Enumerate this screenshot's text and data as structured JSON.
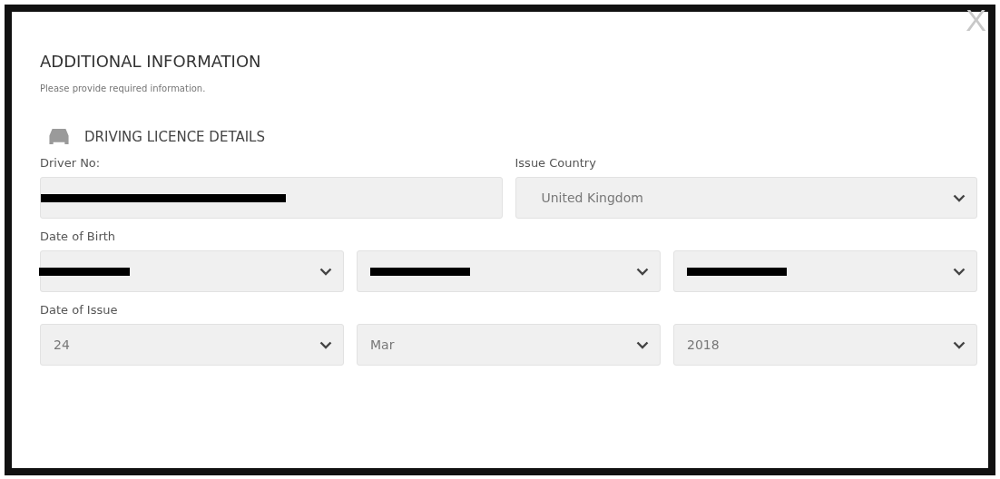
{
  "dialog": {
    "close": "X",
    "title": "ADDITIONAL INFORMATION",
    "subtitle": "Please provide required information."
  },
  "section": {
    "title": "DRIVING LICENCE DETAILS"
  },
  "rows": [
    {
      "fields": [
        {
          "label": "Driver No:",
          "kind": "input",
          "redacted": true
        },
        {
          "label": "Issue Country",
          "kind": "select",
          "value": "United Kingdom",
          "redacted": false
        }
      ]
    },
    {
      "label": "Date of Birth",
      "fields": [
        {
          "kind": "select",
          "redacted": true
        },
        {
          "kind": "select",
          "redacted": true
        },
        {
          "kind": "select",
          "redacted": true
        }
      ]
    },
    {
      "label": "Date of Issue",
      "fields": [
        {
          "kind": "select",
          "value": "24",
          "redacted": false
        },
        {
          "kind": "select",
          "value": "Mar",
          "redacted": false
        },
        {
          "kind": "select",
          "value": "2018",
          "redacted": false
        }
      ]
    }
  ]
}
